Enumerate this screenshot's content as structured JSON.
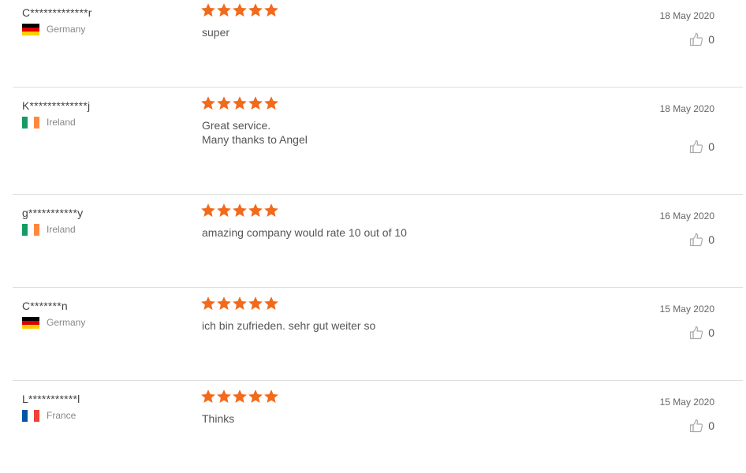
{
  "colors": {
    "star": "#f26a1b",
    "divider": "#dddddd",
    "like_icon": "#aaaaaa"
  },
  "reviews": [
    {
      "name": "C*************r",
      "country": "Germany",
      "flag": "germany",
      "rating": 5,
      "text_lines": [
        "super"
      ],
      "date": "18 May 2020",
      "likes": "0"
    },
    {
      "name": "K*************j",
      "country": "Ireland",
      "flag": "ireland",
      "rating": 5,
      "text_lines": [
        "Great service.",
        "Many thanks to Angel"
      ],
      "date": "18 May 2020",
      "likes": "0"
    },
    {
      "name": "g***********y",
      "country": "Ireland",
      "flag": "ireland",
      "rating": 5,
      "text_lines": [
        "amazing company would rate 10 out of 10"
      ],
      "date": "16 May 2020",
      "likes": "0"
    },
    {
      "name": "C*******n",
      "country": "Germany",
      "flag": "germany",
      "rating": 5,
      "text_lines": [
        "ich bin zufrieden. sehr gut weiter so"
      ],
      "date": "15 May 2020",
      "likes": "0"
    },
    {
      "name": "L***********l",
      "country": "France",
      "flag": "france",
      "rating": 5,
      "text_lines": [
        "Thinks"
      ],
      "date": "15 May 2020",
      "likes": "0"
    }
  ]
}
